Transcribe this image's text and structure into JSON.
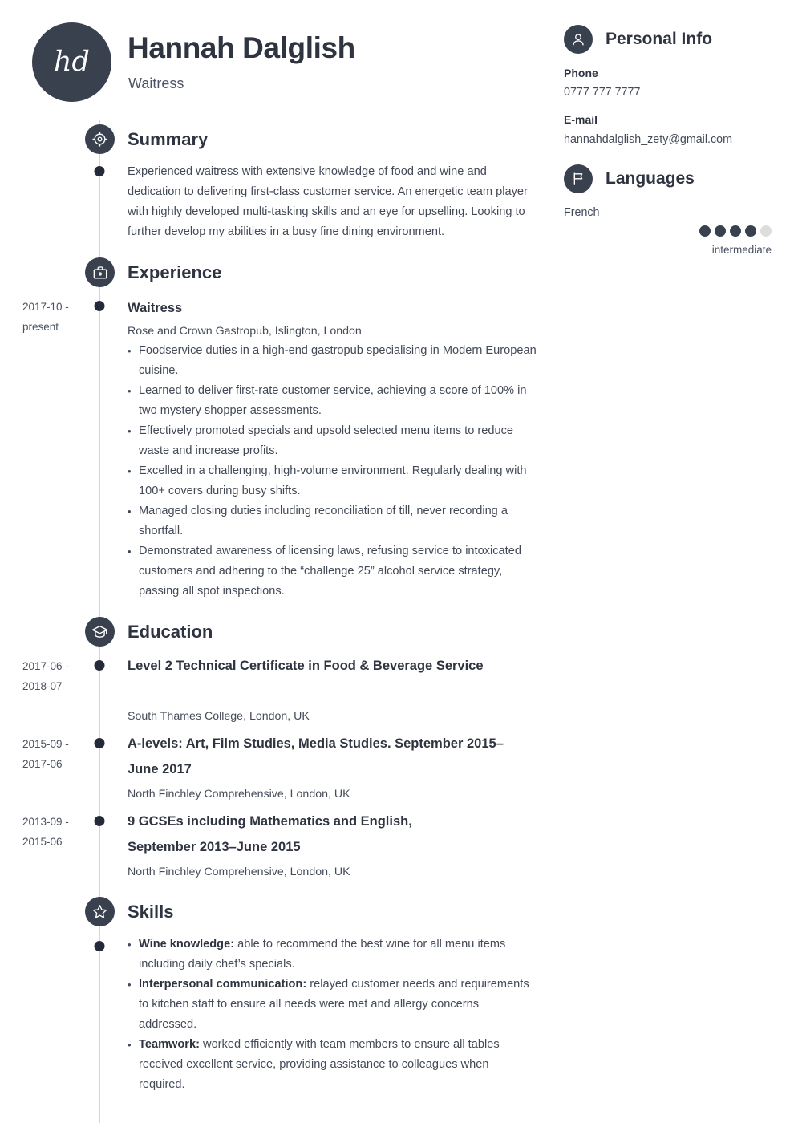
{
  "header": {
    "initials": "hd",
    "name": "Hannah Dalglish",
    "job_title": "Waitress"
  },
  "colors": {
    "accent_dark": "#39414f",
    "heading": "#2e3440",
    "body": "#434a57",
    "rail": "#d6d6d6",
    "dot_off": "#dddddd"
  },
  "sections": {
    "summary": {
      "title": "Summary",
      "icon": "target-icon",
      "text": "Experienced waitress with extensive knowledge of food and wine and dedication to delivering first-class customer service. An energetic team player with highly developed multi-tasking skills and an eye for upselling. Looking to further develop my abilities in a busy fine dining environment."
    },
    "experience": {
      "title": "Experience",
      "icon": "briefcase-icon",
      "entries": [
        {
          "date": "2017-10 - present",
          "role": "Waitress",
          "employer": "Rose and Crown Gastropub, Islington, London",
          "bullets": [
            "Foodservice duties in a high-end gastropub specialising in Modern European cuisine.",
            "Learned to deliver first-rate customer service, achieving a score of 100% in two mystery shopper assessments.",
            "Effectively promoted specials and upsold selected menu items to reduce waste and increase profits.",
            "Excelled in a challenging, high-volume environment. Regularly dealing with 100+ covers during busy shifts.",
            "Managed closing duties including reconciliation of till, never recording a shortfall.",
            "Demonstrated awareness of licensing laws, refusing service to intoxicated customers and adhering to the “challenge 25” alcohol service strategy, passing all spot inspections."
          ]
        }
      ]
    },
    "education": {
      "title": "Education",
      "icon": "graduation-cap-icon",
      "entries": [
        {
          "date": "2017-06 - 2018-07",
          "degree": "Level 2 Technical Certificate in Food & Beverage Service",
          "school": "South Thames College, London, UK"
        },
        {
          "date": "2015-09 - 2017-06",
          "degree": "A-levels: Art, Film Studies, Media Studies. September 2015–June 2017",
          "school": "North Finchley Comprehensive, London, UK"
        },
        {
          "date": "2013-09 - 2015-06",
          "degree": "9 GCSEs including Mathematics and English, September 2013–June 2015",
          "school": "North Finchley Comprehensive, London, UK"
        }
      ]
    },
    "skills": {
      "title": "Skills",
      "icon": "star-icon",
      "items": [
        {
          "label": "Wine knowledge:",
          "text": " able to recommend the best wine for all menu items including daily chef’s specials."
        },
        {
          "label": "Interpersonal communication:",
          "text": " relayed customer needs and requirements to kitchen staff to ensure all needs were met and allergy concerns addressed."
        },
        {
          "label": "Teamwork:",
          "text": " worked efficiently with team members to ensure all tables received excellent service, providing assistance to colleagues when required."
        }
      ]
    }
  },
  "sidebar": {
    "personal_info": {
      "title": "Personal Info",
      "icon": "person-icon",
      "fields": [
        {
          "label": "Phone",
          "value": "0777 777 7777"
        },
        {
          "label": "E-mail",
          "value": "hannahdalglish_zety@gmail.com"
        }
      ]
    },
    "languages": {
      "title": "Languages",
      "icon": "flag-icon",
      "items": [
        {
          "name": "French",
          "level_label": "intermediate",
          "rating": 4,
          "rating_max": 5
        }
      ]
    }
  }
}
